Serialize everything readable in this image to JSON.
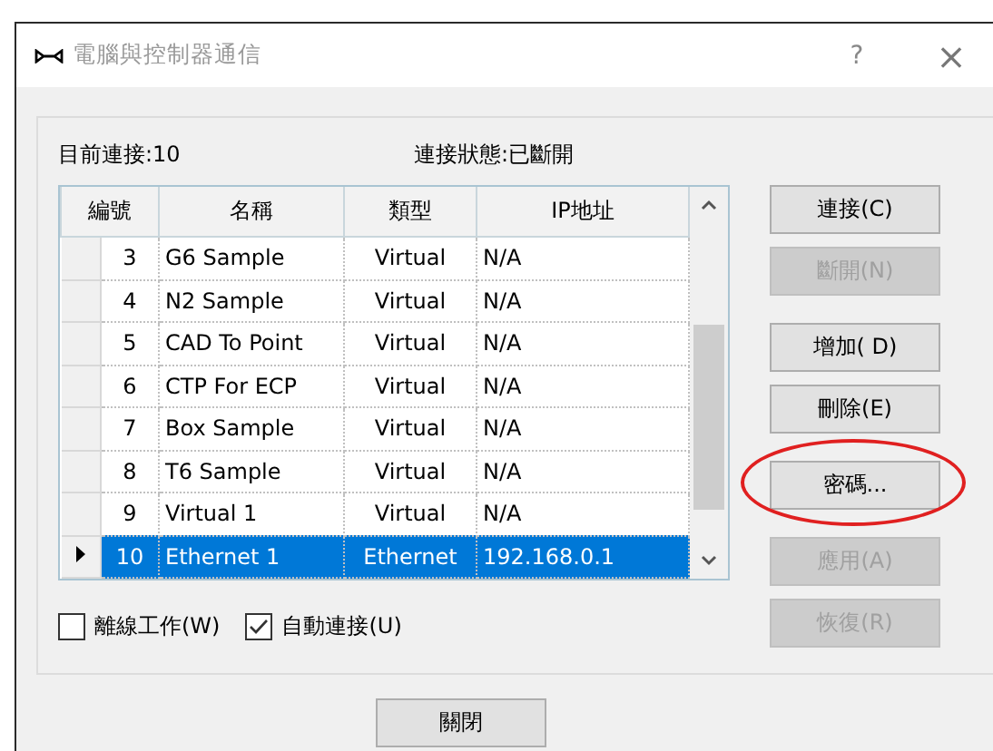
{
  "window": {
    "title": "電腦與控制器通信",
    "help": "?",
    "close": "×"
  },
  "status": {
    "current": "目前連接:10",
    "state": "連接狀態:已斷開"
  },
  "table": {
    "columns": [
      "編號",
      "名稱",
      "類型",
      "IP地址"
    ],
    "rows": [
      {
        "number": "3",
        "name": "G6 Sample",
        "type": "Virtual",
        "ip": "N/A",
        "selected": false
      },
      {
        "number": "4",
        "name": "N2 Sample",
        "type": "Virtual",
        "ip": "N/A",
        "selected": false
      },
      {
        "number": "5",
        "name": "CAD To Point",
        "type": "Virtual",
        "ip": "N/A",
        "selected": false
      },
      {
        "number": "6",
        "name": "CTP For ECP",
        "type": "Virtual",
        "ip": "N/A",
        "selected": false
      },
      {
        "number": "7",
        "name": "Box Sample",
        "type": "Virtual",
        "ip": "N/A",
        "selected": false
      },
      {
        "number": "8",
        "name": "T6 Sample",
        "type": "Virtual",
        "ip": "N/A",
        "selected": false
      },
      {
        "number": "9",
        "name": "Virtual 1",
        "type": "Virtual",
        "ip": "N/A",
        "selected": false
      },
      {
        "number": "10",
        "name": "Ethernet 1",
        "type": "Ethernet",
        "ip": "192.168.0.1",
        "selected": true
      }
    ]
  },
  "button_groups": [
    [
      {
        "label": "連接(C)",
        "disabled": false,
        "highlighted": false
      },
      {
        "label": "斷開(N)",
        "disabled": true,
        "highlighted": false
      }
    ],
    [
      {
        "label": "增加( D)",
        "disabled": false,
        "highlighted": false
      },
      {
        "label": "刪除(E)",
        "disabled": false,
        "highlighted": false
      }
    ],
    [
      {
        "label": "密碼...",
        "disabled": false,
        "highlighted": true
      }
    ],
    [
      {
        "label": "應用(A)",
        "disabled": true,
        "highlighted": false
      },
      {
        "label": "恢復(R)",
        "disabled": true,
        "highlighted": false
      }
    ]
  ],
  "options": [
    {
      "label": "離線工作(W)",
      "checked": false
    },
    {
      "label": "自動連接(U)",
      "checked": true
    }
  ],
  "footer_button": {
    "label": "關閉"
  }
}
